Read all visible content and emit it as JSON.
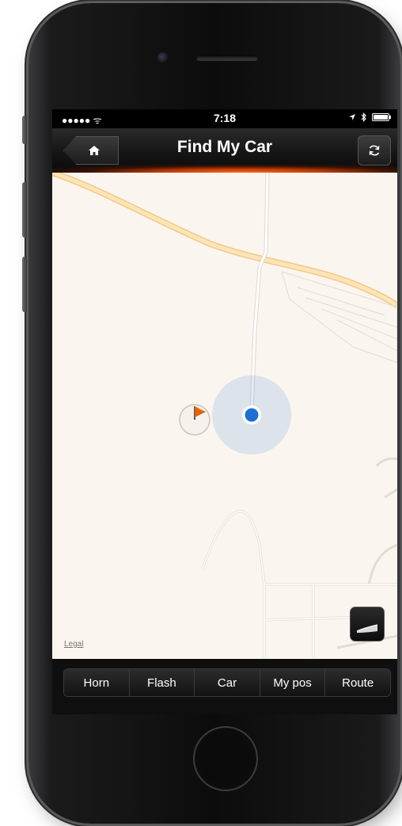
{
  "status_bar": {
    "signal": "●●●●● ᯤ",
    "time": "7:18",
    "location_icon": "location-arrow-icon",
    "bluetooth_icon": "bluetooth-icon",
    "battery_icon": "battery-icon"
  },
  "nav": {
    "title": "Find My Car",
    "home_icon": "home-icon",
    "refresh_icon": "refresh-icon"
  },
  "map": {
    "legal_label": "Legal"
  },
  "tabs": [
    {
      "label": "Horn"
    },
    {
      "label": "Flash"
    },
    {
      "label": "Car"
    },
    {
      "label": "My pos"
    },
    {
      "label": "Route"
    }
  ],
  "colors": {
    "accent": "#ff6a1a",
    "user_location": "#1f6fd1",
    "map_background": "#faf5ee",
    "road": "#f6d6a0"
  }
}
